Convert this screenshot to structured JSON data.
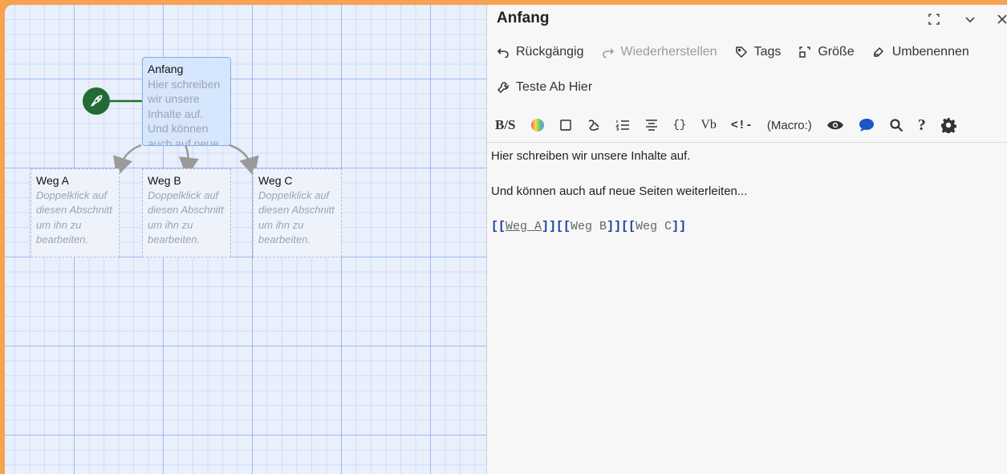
{
  "canvas": {
    "start_passage": {
      "title": "Anfang",
      "excerpt": "Hier schreiben wir unsere Inhalte auf. Und können auch auf neue Seiten"
    },
    "passages": [
      {
        "title": "Weg A",
        "excerpt": "Doppelklick auf diesen Abschnitt um ihn zu bearbeiten."
      },
      {
        "title": "Weg B",
        "excerpt": "Doppelklick auf diesen Abschnitt um ihn zu bearbeiten."
      },
      {
        "title": "Weg C",
        "excerpt": "Doppelklick auf diesen Abschnitt um ihn zu bearbeiten."
      }
    ],
    "start_icon": "rocket-icon"
  },
  "panel": {
    "title": "Anfang",
    "toolbar1": {
      "undo": "Rückgängig",
      "redo": "Wiederherstellen",
      "tags": "Tags",
      "size": "Größe",
      "rename": "Umbenennen"
    },
    "toolbar2": {
      "test_from_here": "Teste Ab Hier"
    },
    "format_toolbar": {
      "macro": "(Macro:)",
      "vb": "Vb",
      "braces": "{}",
      "comment": "<!-",
      "help": "?"
    },
    "editor": {
      "line1": "Hier schreiben wir unsere Inhalte auf.",
      "line2": "Und können auch auf neue Seiten weiterleiten...",
      "links": [
        "Weg A",
        "Weg B",
        "Weg C"
      ]
    }
  },
  "colors": {
    "accent_frame": "#f7a24e",
    "start_passage_bg": "#d6e6fc",
    "rocket_bg": "#236b35",
    "link_bracket": "#1a3da0"
  }
}
